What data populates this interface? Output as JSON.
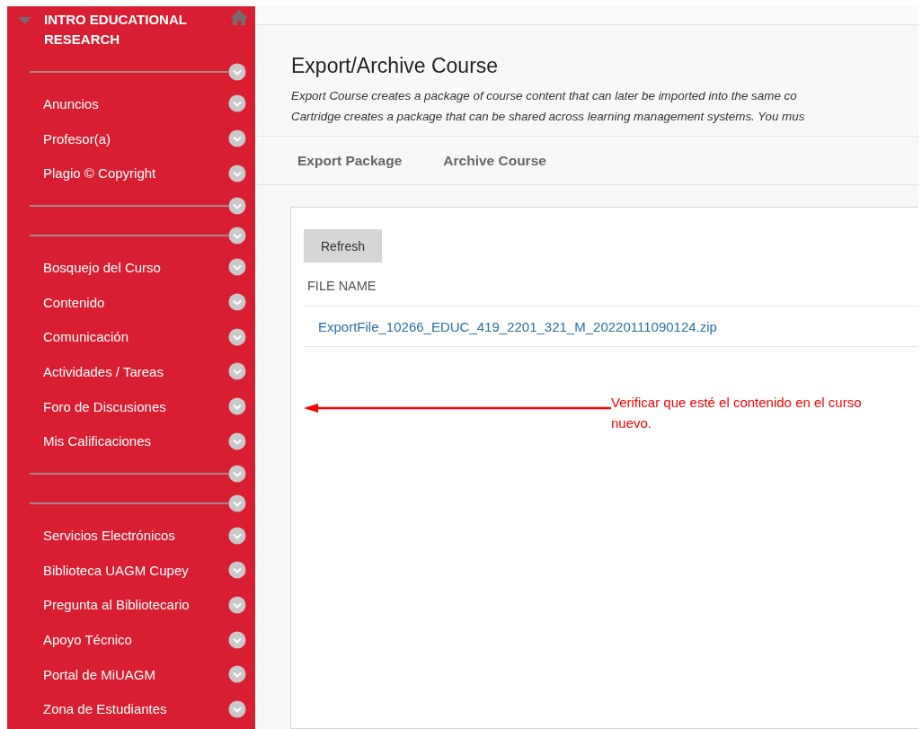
{
  "sidebar": {
    "title": "INTRO EDUCATIONAL RESEARCH",
    "expanded": true,
    "items": [
      {
        "kind": "divider"
      },
      {
        "kind": "link",
        "label": "Anuncios"
      },
      {
        "kind": "link",
        "label": "Profesor(a)"
      },
      {
        "kind": "link",
        "label": "Plagio © Copyright"
      },
      {
        "kind": "divider"
      },
      {
        "kind": "divider"
      },
      {
        "kind": "link",
        "label": "Bosquejo del Curso"
      },
      {
        "kind": "link",
        "label": "Contenido"
      },
      {
        "kind": "link",
        "label": "Comunicación"
      },
      {
        "kind": "link",
        "label": "Actividades / Tareas"
      },
      {
        "kind": "link",
        "label": "Foro de Discusiones"
      },
      {
        "kind": "link",
        "label": "Mis Calificaciones"
      },
      {
        "kind": "divider"
      },
      {
        "kind": "divider"
      },
      {
        "kind": "link",
        "label": "Servicios Electrónicos"
      },
      {
        "kind": "link",
        "label": "Biblioteca UAGM Cupey"
      },
      {
        "kind": "link",
        "label": "Pregunta al Bibliotecario"
      },
      {
        "kind": "link",
        "label": "Apoyo Técnico"
      },
      {
        "kind": "link",
        "label": "Portal de MiUAGM"
      },
      {
        "kind": "link",
        "label": "Zona de Estudiantes"
      }
    ]
  },
  "page": {
    "title": "Export/Archive Course",
    "description": [
      "Export Course creates a package of course content that can later be imported into the same co",
      "Cartridge creates a package that can be shared across learning management systems. You mus"
    ]
  },
  "actions": [
    "Export Package",
    "Archive Course"
  ],
  "panel": {
    "button": "Refresh",
    "table": {
      "columns": [
        "FILE NAME"
      ],
      "rows": [
        {
          "file_name": "ExportFile_10266_EDUC_419_2201_321_M_20220111090124.zip"
        }
      ]
    }
  },
  "annotation": {
    "text": "Verificar que esté el contenido en el curso nuevo."
  }
}
